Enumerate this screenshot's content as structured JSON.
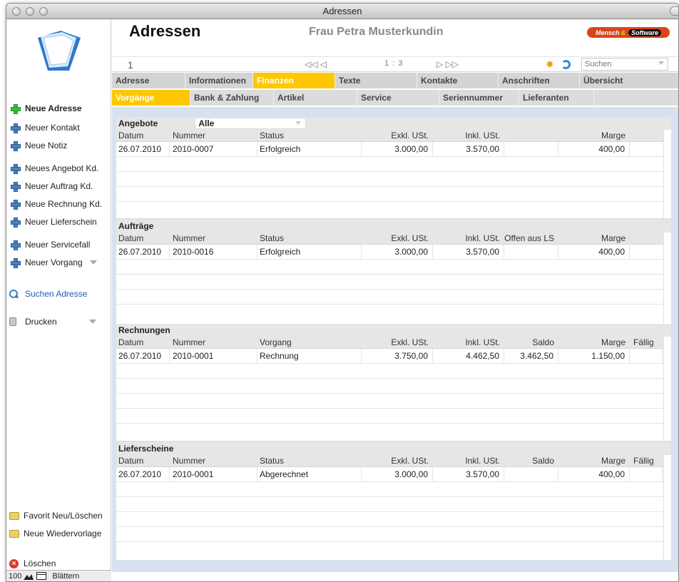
{
  "window": {
    "title": "Adressen"
  },
  "header": {
    "app_title": "Adressen",
    "customer_name": "Frau Petra Musterkundin",
    "brand_left": "Mensch",
    "brand_amp": "&",
    "brand_right": "Software"
  },
  "nav": {
    "record_number": "1",
    "first_prev": "◁◁ ◁",
    "record_count": "1 : 3",
    "next_last": "▷ ▷▷",
    "search_placeholder": "Suchen"
  },
  "tabs_main": [
    "Adresse",
    "Informationen",
    "Finanzen",
    "Texte",
    "Kontakte",
    "Anschriften",
    "Übersicht"
  ],
  "tabs_sub": [
    "Vorgänge",
    "Bank & Zahlung",
    "Artikel",
    "Service",
    "Seriennummer",
    "Lieferanten"
  ],
  "sidebar": {
    "items": [
      {
        "label": "Neue Adresse"
      },
      {
        "label": "Neuer Kontakt"
      },
      {
        "label": "Neue Notiz"
      },
      {
        "label": "Neues Angebot Kd."
      },
      {
        "label": "Neuer Auftrag Kd."
      },
      {
        "label": "Neue Rechnung Kd."
      },
      {
        "label": "Neuer Lieferschein"
      },
      {
        "label": "Neuer Servicefall"
      },
      {
        "label": "Neuer Vorgang"
      },
      {
        "label": "Suchen Adresse"
      },
      {
        "label": "Drucken"
      }
    ],
    "footer": {
      "favorite": "Favorit Neu/Löschen",
      "reminder": "Neue Wiedervorlage",
      "delete": "Löschen"
    },
    "status": {
      "zoom": "100",
      "mode": "Blättern"
    }
  },
  "sections": {
    "angebote": {
      "title": "Angebote",
      "filter": "Alle",
      "headers": [
        "Datum",
        "Nummer",
        "Status",
        "Exkl. USt.",
        "Inkl. USt.",
        "",
        "Marge"
      ],
      "rows": [
        [
          "26.07.2010",
          "2010-0007",
          "Erfolgreich",
          "3.000,00",
          "3.570,00",
          "",
          "400,00"
        ]
      ]
    },
    "auftraege": {
      "title": "Aufträge",
      "headers": [
        "Datum",
        "Nummer",
        "Status",
        "Exkl. USt.",
        "Inkl. USt.",
        "Offen aus LS",
        "Marge"
      ],
      "rows": [
        [
          "26.07.2010",
          "2010-0016",
          "Erfolgreich",
          "3.000,00",
          "3.570,00",
          "",
          "400,00"
        ]
      ]
    },
    "rechnungen": {
      "title": "Rechnungen",
      "headers": [
        "Datum",
        "Nummer",
        "Vorgang",
        "Exkl. USt.",
        "Inkl. USt.",
        "Saldo",
        "Marge",
        "Fällig"
      ],
      "rows": [
        [
          "26.07.2010",
          "2010-0001",
          "Rechnung",
          "3.750,00",
          "4.462,50",
          "3.462,50",
          "1.150,00",
          ""
        ]
      ]
    },
    "lieferscheine": {
      "title": "Lieferscheine",
      "headers": [
        "Datum",
        "Nummer",
        "Status",
        "Exkl. USt.",
        "Inkl. USt.",
        "Saldo",
        "Marge",
        "Fällig"
      ],
      "rows": [
        [
          "26.07.2010",
          "2010-0001",
          "Abgerechnet",
          "3.000,00",
          "3.570,00",
          "",
          "400,00",
          ""
        ]
      ]
    }
  },
  "colors": {
    "active_tab": "#ffc700",
    "content_bg": "#d8e1ef",
    "brand": "#d8451a"
  }
}
